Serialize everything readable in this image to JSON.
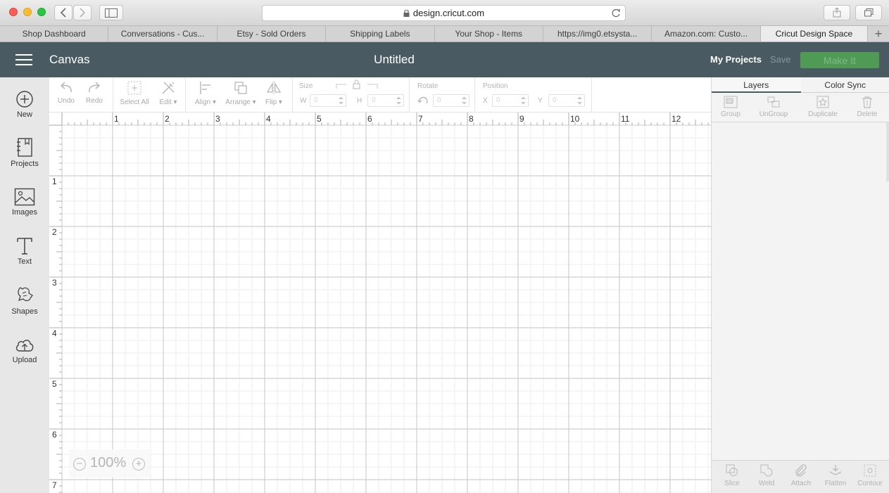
{
  "browser": {
    "url": "design.cricut.com",
    "tabs": [
      {
        "label": "Shop Dashboard",
        "active": false
      },
      {
        "label": "Conversations - Cus...",
        "active": false
      },
      {
        "label": "Etsy - Sold Orders",
        "active": false
      },
      {
        "label": "Shipping Labels",
        "active": false
      },
      {
        "label": "Your Shop - Items",
        "active": false
      },
      {
        "label": "https://img0.etsysta...",
        "active": false
      },
      {
        "label": "Amazon.com: Custo...",
        "active": false
      },
      {
        "label": "Cricut Design Space",
        "active": true
      }
    ]
  },
  "header": {
    "section": "Canvas",
    "document_title": "Untitled",
    "my_projects": "My Projects",
    "save": "Save",
    "make_it": "Make It"
  },
  "sidebar": {
    "items": [
      {
        "label": "New",
        "icon": "plus-circle-icon"
      },
      {
        "label": "Projects",
        "icon": "notebook-icon"
      },
      {
        "label": "Images",
        "icon": "image-icon"
      },
      {
        "label": "Text",
        "icon": "text-icon"
      },
      {
        "label": "Shapes",
        "icon": "shapes-icon"
      },
      {
        "label": "Upload",
        "icon": "cloud-upload-icon"
      }
    ]
  },
  "toolbar": {
    "undo": "Undo",
    "redo": "Redo",
    "select_all": "Select All",
    "edit": "Edit",
    "align": "Align",
    "arrange": "Arrange",
    "flip": "Flip",
    "size": {
      "label": "Size",
      "w_label": "W",
      "h_label": "H",
      "w_value": "0",
      "h_value": "0"
    },
    "rotate": {
      "label": "Rotate",
      "value": "0"
    },
    "position": {
      "label": "Position",
      "x_label": "X",
      "y_label": "Y",
      "x_value": "0",
      "y_value": "0"
    }
  },
  "canvas": {
    "ruler_top": [
      "1",
      "2",
      "3",
      "4",
      "5",
      "6",
      "7",
      "8",
      "9",
      "10",
      "11",
      "12"
    ],
    "ruler_left": [
      "1",
      "2",
      "3",
      "4",
      "5",
      "6",
      "7"
    ],
    "zoom": "100%",
    "zoom_out": "−",
    "zoom_in": "+"
  },
  "right_panel": {
    "tabs": [
      "Layers",
      "Color Sync"
    ],
    "top_tools": [
      "Group",
      "UnGroup",
      "Duplicate",
      "Delete"
    ],
    "bottom_tools": [
      "Slice",
      "Weld",
      "Attach",
      "Flatten",
      "Contour"
    ]
  },
  "colors": {
    "header_bg": "#4a5a62",
    "make_it_bg": "#4f9a54",
    "sidebar_bg": "#e7e7e7"
  }
}
